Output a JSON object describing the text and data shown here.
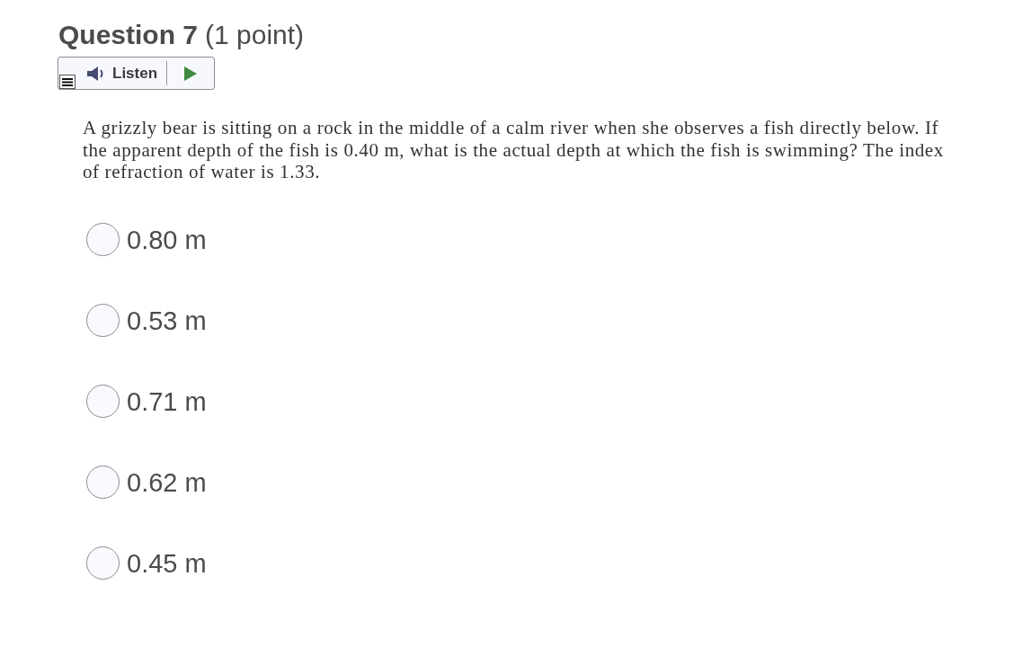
{
  "header": {
    "question": "Question 7",
    "points": "(1 point)"
  },
  "listen": {
    "label": "Listen"
  },
  "prompt": "A grizzly bear is sitting on a rock in the middle of a calm river when she observes a fish directly below. If the apparent depth of the fish is 0.40 m, what is the actual depth at which the fish is swimming? The index of refraction of water is 1.33.",
  "options": [
    {
      "label": "0.80 m",
      "selected": false
    },
    {
      "label": "0.53 m",
      "selected": false
    },
    {
      "label": "0.71 m",
      "selected": false
    },
    {
      "label": "0.62 m",
      "selected": false
    },
    {
      "label": "0.45 m",
      "selected": false
    }
  ]
}
